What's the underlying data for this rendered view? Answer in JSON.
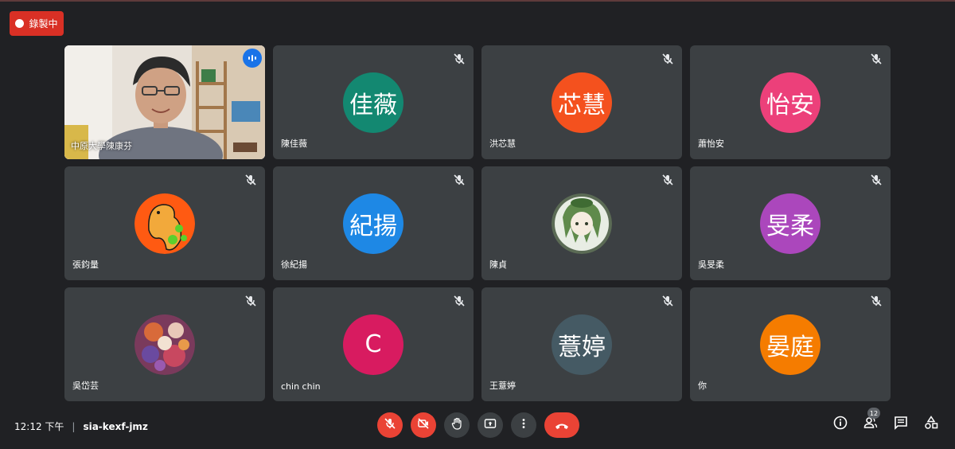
{
  "recording": {
    "label": "錄製中"
  },
  "participants": [
    {
      "name": "中原大學陳康芬",
      "type": "video"
    },
    {
      "name": "陳佳薇",
      "initials": "佳薇",
      "color": "#138871",
      "muted": true
    },
    {
      "name": "洪芯慧",
      "initials": "芯慧",
      "color": "#f4511e",
      "muted": true
    },
    {
      "name": "蕭怡安",
      "initials": "怡安",
      "color": "#ec407a",
      "muted": true
    },
    {
      "name": "張鈞量",
      "type": "image",
      "image": "orange-dinosaur-drawing",
      "muted": true
    },
    {
      "name": "徐紀揚",
      "initials": "紀揚",
      "color": "#1e88e5",
      "muted": true
    },
    {
      "name": "陳貞",
      "type": "image",
      "image": "green-anime-character",
      "muted": true
    },
    {
      "name": "吳旻柔",
      "initials": "旻柔",
      "color": "#ab47bc",
      "muted": true
    },
    {
      "name": "吳岱芸",
      "type": "image",
      "image": "colorful-illustration",
      "muted": true
    },
    {
      "name": "chin chin",
      "initials": "C",
      "color": "#d81b60",
      "muted": true
    },
    {
      "name": "王薏婷",
      "initials": "薏婷",
      "color": "#455a64",
      "muted": true
    },
    {
      "name": "你",
      "initials": "晏庭",
      "color": "#f57c00",
      "muted": true
    }
  ],
  "meeting": {
    "time": "12:12 下午",
    "separator": "|",
    "code": "sia-kexf-jmz"
  },
  "controls": [
    "mic-off-icon",
    "camera-off-icon",
    "raise-hand-icon",
    "present-screen-icon",
    "more-options-icon",
    "hang-up-icon"
  ],
  "tools": {
    "people_count": "12",
    "icons": [
      "info-icon",
      "people-icon",
      "chat-icon",
      "activities-icon"
    ]
  },
  "colors": {
    "background": "#202124",
    "tile": "#3c4043",
    "danger": "#ea4335",
    "speaking": "#8ab4f8"
  }
}
